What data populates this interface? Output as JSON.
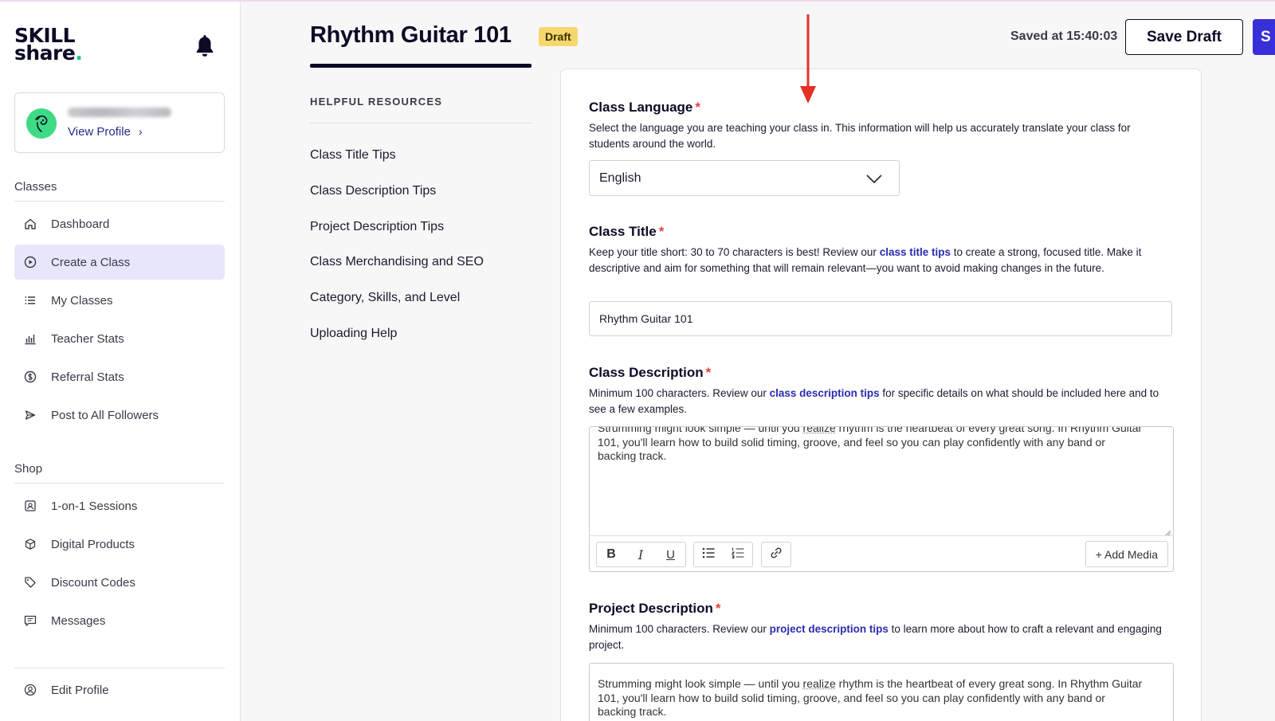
{
  "app": {
    "logo_line1": "SKILL",
    "logo_line2": "share",
    "logo_dot": "."
  },
  "sidebar": {
    "profile": {
      "name": "",
      "view_profile": "View Profile"
    },
    "classes_section": "Classes",
    "classes_items": [
      {
        "label": "Dashboard",
        "icon": "home-icon"
      },
      {
        "label": "Create a Class",
        "icon": "play-circle-icon",
        "active": true
      },
      {
        "label": "My Classes",
        "icon": "list-icon"
      },
      {
        "label": "Teacher Stats",
        "icon": "bar-chart-icon"
      },
      {
        "label": "Referral Stats",
        "icon": "dollar-circle-icon"
      },
      {
        "label": "Post to All Followers",
        "icon": "send-icon"
      }
    ],
    "shop_section": "Shop",
    "shop_items": [
      {
        "label": "1-on-1 Sessions",
        "icon": "person-card-icon"
      },
      {
        "label": "Digital Products",
        "icon": "box-icon"
      },
      {
        "label": "Discount Codes",
        "icon": "tag-icon"
      },
      {
        "label": "Messages",
        "icon": "message-icon"
      }
    ],
    "edit_profile": {
      "label": "Edit Profile",
      "icon": "user-circle-icon"
    }
  },
  "header": {
    "title": "Rhythm Guitar 101",
    "badge": "Draft",
    "saved_at": "Saved at 15:40:03",
    "save_draft": "Save Draft",
    "submit_partial": "S"
  },
  "resources": {
    "title": "HELPFUL RESOURCES",
    "links": [
      "Class Title Tips",
      "Class Description Tips",
      "Project Description Tips",
      "Class Merchandising and SEO",
      "Category, Skills, and Level",
      "Uploading Help"
    ]
  },
  "form": {
    "language": {
      "label": "Class Language",
      "required": "*",
      "helper": "Select the language you are teaching your class in. This information will help us accurately translate your class for students around the world.",
      "value": "English"
    },
    "title": {
      "label": "Class Title",
      "required": "*",
      "helper_pre": "Keep your title short: 30 to 70 characters is best! Review our ",
      "helper_link": "class title tips",
      "helper_post": " to create a strong, focused title. Make it descriptive and aim for something that will remain relevant—you want to avoid making changes in the future.",
      "value": "Rhythm Guitar 101"
    },
    "description": {
      "label": "Class Description",
      "required": "*",
      "helper_pre": "Minimum 100 characters. Review our ",
      "helper_link": "class description tips",
      "helper_post": " for specific details on what should be included here and to see a few examples.",
      "text_line1_pre": "Strumming might look simple — until you ",
      "text_line1_sq": "realize",
      "text_line1_post": " rhythm is the heartbeat of every great song. In Rhythm Guitar",
      "text_line2": "101, you'll learn how to build solid timing, groove, and feel so you can play confidently with any band or",
      "text_line3": "backing track.",
      "add_media": "+ Add Media"
    },
    "project": {
      "label": "Project Description",
      "required": "*",
      "helper_pre": "Minimum 100 characters. Review our ",
      "helper_link": "project description tips",
      "helper_post": " to learn more about how to craft a relevant and engaging project.",
      "text_line1_pre": "Strumming might look simple — until you ",
      "text_line1_sq": "realize",
      "text_line1_post": " rhythm is the heartbeat of every great song. In Rhythm Guitar",
      "text_line2": "101, you'll learn how to build solid timing, groove, and feel so you can play confidently with any band or",
      "text_line3": "backing track."
    }
  },
  "colors": {
    "accent": "#3730d9",
    "active_nav": "#e8e6fb",
    "badge": "#f5d76e",
    "required": "#e0463c",
    "link": "#2b2bb0",
    "annotation": "#e53227"
  }
}
